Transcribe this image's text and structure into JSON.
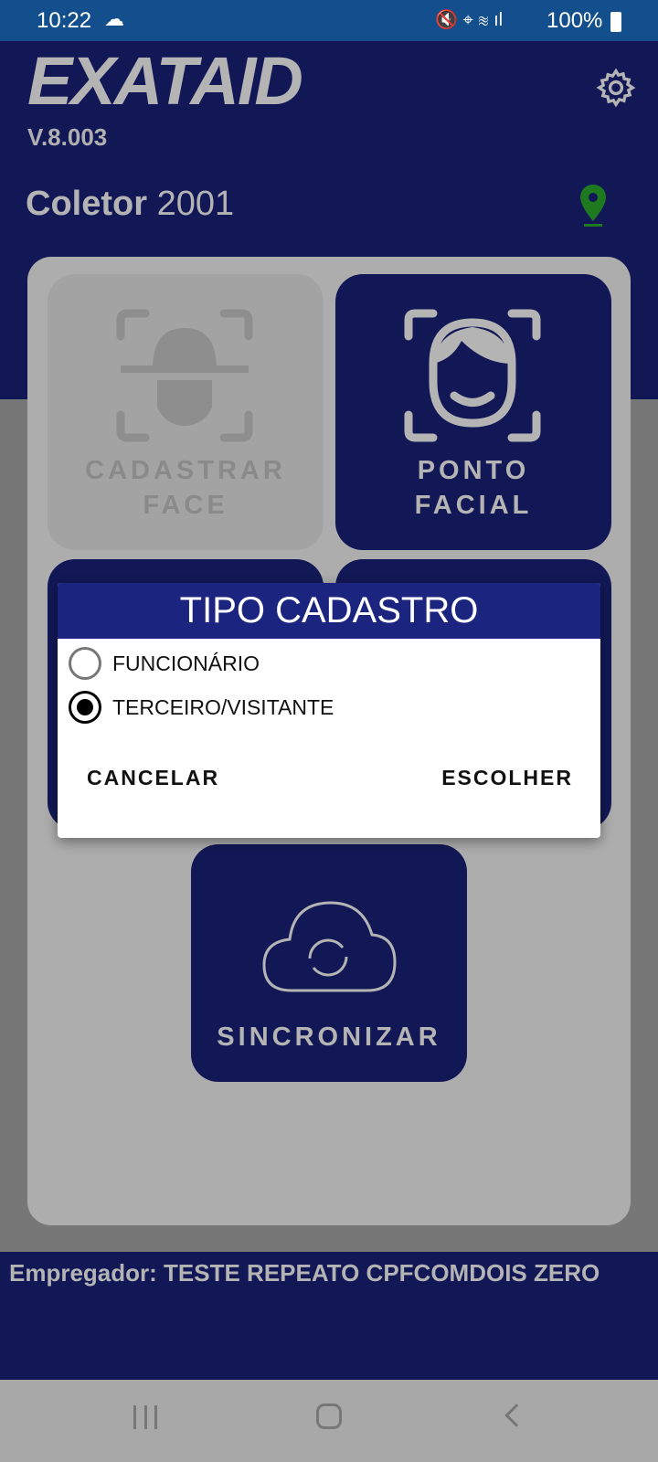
{
  "status_bar": {
    "time": "10:22",
    "battery": "100%"
  },
  "header": {
    "logo": "EXATAID",
    "version": "V.8.003",
    "collector_label": "Coletor",
    "collector_value": "2001"
  },
  "tiles": [
    {
      "label_1": "CADASTRAR",
      "label_2": "FACE"
    },
    {
      "label_1": "PONTO",
      "label_2": "FACIAL"
    },
    {
      "label": "SINCRONIZAR"
    }
  ],
  "dialog": {
    "title": "TIPO CADASTRO",
    "options": [
      {
        "label": "FUNCIONÁRIO",
        "selected": false
      },
      {
        "label": "TERCEIRO/VISITANTE",
        "selected": true
      }
    ],
    "cancel": "CANCELAR",
    "confirm": "ESCOLHER"
  },
  "footer": {
    "employer": "Empregador: TESTE REPEATO CPFCOMDOIS ZERO"
  },
  "colors": {
    "header": "#121856",
    "dialog_header": "#1b2580",
    "location": "#1f7a1f"
  }
}
